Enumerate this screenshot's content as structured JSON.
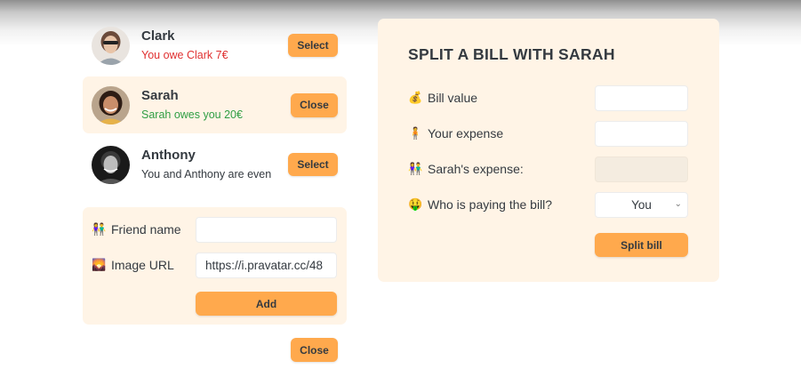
{
  "friends": [
    {
      "name": "Clark",
      "balance": "You owe Clark 7€",
      "button": "Select"
    },
    {
      "name": "Sarah",
      "balance": "Sarah owes you 20€",
      "button": "Close"
    },
    {
      "name": "Anthony",
      "balance": "You and Anthony are even",
      "button": "Select"
    }
  ],
  "add_form": {
    "name_emoji": "👫",
    "name_label": "Friend name",
    "name_value": "",
    "image_emoji": "🌄",
    "image_label": "Image URL",
    "image_value": "https://i.pravatar.cc/48",
    "add_button": "Add"
  },
  "close_button": "Close",
  "split": {
    "title": "SPLIT A BILL WITH SARAH",
    "bill_emoji": "💰",
    "bill_label": "Bill value",
    "expense_emoji": "🧍",
    "expense_label": "Your expense",
    "friend_emoji": "👫",
    "friend_label": "Sarah's expense:",
    "payer_emoji": "🤑",
    "payer_label": "Who is paying the bill?",
    "payer_value": "You",
    "split_button": "Split bill"
  },
  "colors": {
    "accent": "#ffa94d",
    "panel": "#fff4e6",
    "owe": "#e03131",
    "owed": "#2f9e44"
  }
}
